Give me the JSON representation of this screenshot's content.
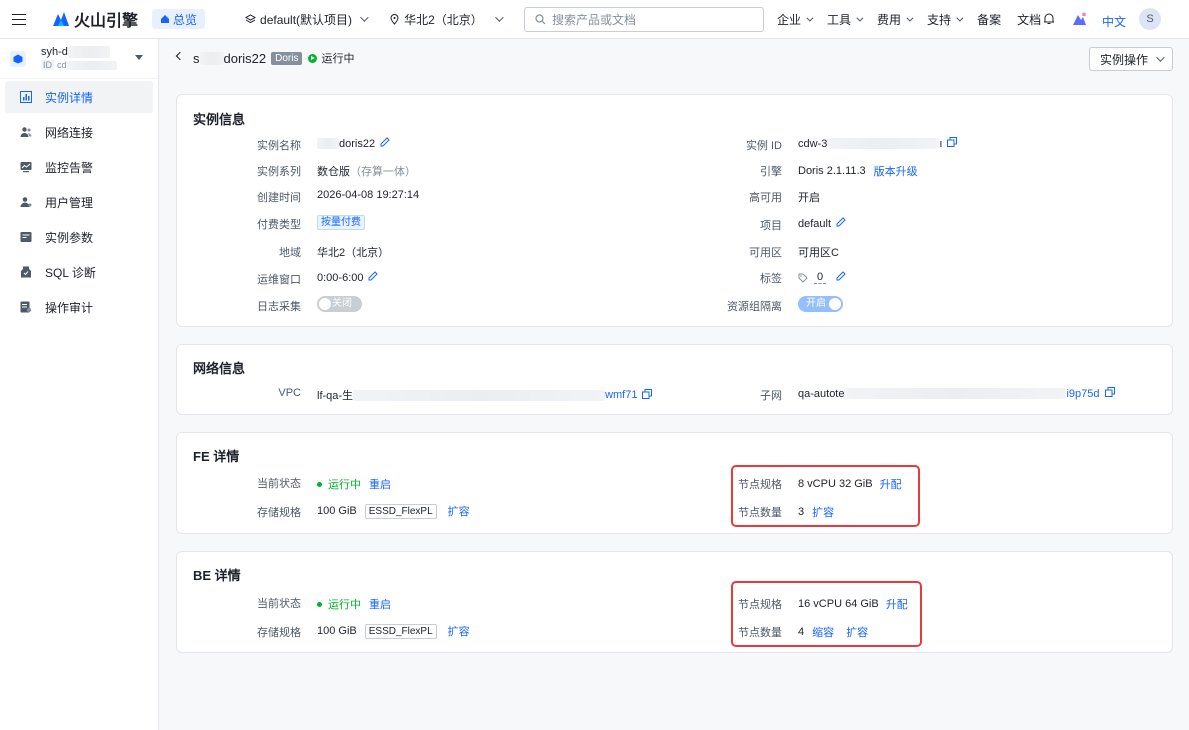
{
  "topbar": {
    "brand": "火山引擎",
    "home_label": "总览",
    "project": "default(默认项目)",
    "region": "华北2（北京）",
    "search_placeholder": "搜索产品或文档",
    "nav": [
      "企业",
      "工具",
      "费用",
      "支持",
      "备案",
      "文档"
    ],
    "lang": "中文",
    "avatar": "S"
  },
  "sidebar": {
    "instance_name": "syh-d",
    "instance_id_prefix": "ID",
    "instance_id": "cd",
    "items": [
      {
        "label": "实例详情",
        "icon": "chart-icon",
        "active": true
      },
      {
        "label": "网络连接",
        "icon": "users-icon",
        "active": false
      },
      {
        "label": "监控告警",
        "icon": "monitor-icon",
        "active": false
      },
      {
        "label": "用户管理",
        "icon": "user-icon",
        "active": false
      },
      {
        "label": "实例参数",
        "icon": "params-icon",
        "active": false
      },
      {
        "label": "SQL 诊断",
        "icon": "diagnose-icon",
        "active": false
      },
      {
        "label": "操作审计",
        "icon": "audit-icon",
        "active": false
      }
    ]
  },
  "header": {
    "title_prefix": "s",
    "title": "doris22",
    "engine_tag": "Doris",
    "status": "运行中",
    "ops_label": "实例操作"
  },
  "instance_info": {
    "title": "实例信息",
    "left": [
      {
        "label": "实例名称",
        "value": "doris22"
      },
      {
        "label": "实例系列",
        "value": "数仓版",
        "note": "（存算一体）"
      },
      {
        "label": "创建时间",
        "value": "2026-04-08 19:27:14"
      },
      {
        "label": "付费类型",
        "value": "按量付费"
      },
      {
        "label": "地域",
        "value": "华北2（北京）"
      },
      {
        "label": "运维窗口",
        "value": "0:00-6:00"
      },
      {
        "label": "日志采集",
        "value": "关闭"
      }
    ],
    "right": [
      {
        "label": "实例 ID",
        "value": "cdw-3",
        "suffix": "ı"
      },
      {
        "label": "引擎",
        "value": "Doris 2.1.11.3",
        "link": "版本升级"
      },
      {
        "label": "高可用",
        "value": "开启"
      },
      {
        "label": "项目",
        "value": "default"
      },
      {
        "label": "可用区",
        "value": "可用区C"
      },
      {
        "label": "标签",
        "value": "0"
      },
      {
        "label": "资源组隔离",
        "value": "开启"
      }
    ]
  },
  "network_info": {
    "title": "网络信息",
    "vpc_label": "VPC",
    "vpc_prefix": "lf-qa-生",
    "vpc_suffix": "wmf71",
    "subnet_label": "子网",
    "subnet_prefix": "qa-autote",
    "subnet_suffix": "i9p75d"
  },
  "fe": {
    "title": "FE 详情",
    "status_label": "当前状态",
    "status": "运行中",
    "restart": "重启",
    "storage_label": "存储规格",
    "storage": "100 GiB",
    "storage_type": "ESSD_FlexPL",
    "expand": "扩容",
    "spec_label": "节点规格",
    "spec": "8 vCPU 32 GiB",
    "upgrade": "升配",
    "count_label": "节点数量",
    "count": "3",
    "count_expand": "扩容"
  },
  "be": {
    "title": "BE 详情",
    "status_label": "当前状态",
    "status": "运行中",
    "restart": "重启",
    "storage_label": "存储规格",
    "storage": "100 GiB",
    "storage_type": "ESSD_FlexPL",
    "expand": "扩容",
    "spec_label": "节点规格",
    "spec": "16 vCPU 64 GiB",
    "upgrade": "升配",
    "count_label": "节点数量",
    "count": "4",
    "count_shrink": "缩容",
    "count_expand": "扩容"
  },
  "colors": {
    "accent": "#1664ff",
    "running": "#00b42a",
    "highlight": "#e83a3a"
  }
}
